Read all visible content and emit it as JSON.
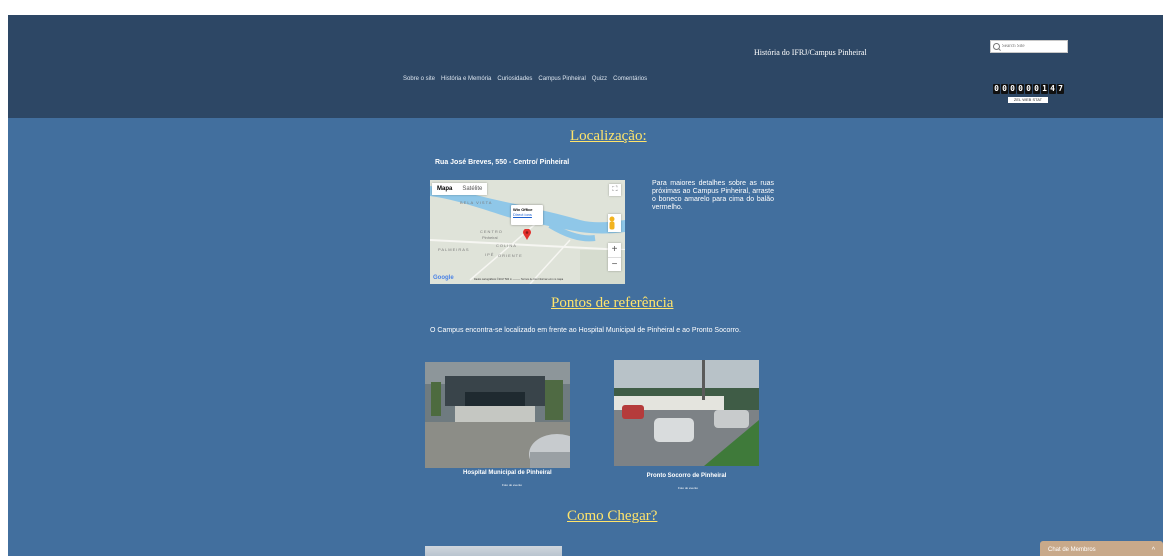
{
  "nav": [
    "Sobre o site",
    "História e Memória",
    "Curiosidades",
    "Campus Pinheiral",
    "Quizz",
    "Comentários"
  ],
  "site_title": "História do IFRJ/Campus Pinheiral",
  "search": {
    "placeholder": "Search Site"
  },
  "counter": {
    "digits": "000000147",
    "label": "ZEL WEB STAT"
  },
  "localizacao": {
    "heading": "Localização:",
    "address": "Rua José Breves, 550 - Centro/ Pinheiral",
    "info": "Para maiores detalhes sobre as ruas próximas ao Campus Pinheiral, arraste o boneco amarelo para cima do balão vermelho."
  },
  "map": {
    "tab_map": "Mapa",
    "tab_satellite": "Satélite",
    "popup_title": "Wix Office",
    "popup_link": "Direct ions",
    "labels": [
      "BELA VISTA",
      "CENTRO",
      "Pinheiral",
      "COLINA",
      "PALMEIRAS",
      "IPÊ",
      "ORIENTE"
    ],
    "google": "Google",
    "footer": "Dados cartográficos ©2017   500 m ———   Termos de Uso   Informar erro no mapa",
    "zoom_in": "+",
    "zoom_out": "−",
    "colors": {
      "land": "#dfe3d9",
      "river": "#8fc7e8",
      "pin": "#e2302b",
      "pegman": "#f2b31f"
    }
  },
  "pontos": {
    "heading": "Pontos de referência",
    "text": "O Campus encontra-se localizado em frente ao Hospital Municipal de Pinheiral e ao Pronto Socorro.",
    "photos": [
      {
        "caption": "Hospital Municipal de Pinheiral",
        "subcaption": "Foto do evento"
      },
      {
        "caption": "Pronto Socorro de Pinheiral",
        "subcaption": "Foto do evento"
      }
    ]
  },
  "como_chegar": {
    "heading": "Como Chegar?"
  },
  "chat": {
    "label": "Chat de Membros"
  },
  "colors": {
    "header": "#2d4765",
    "page": "#426f9e",
    "heading": "#ffe46b"
  }
}
